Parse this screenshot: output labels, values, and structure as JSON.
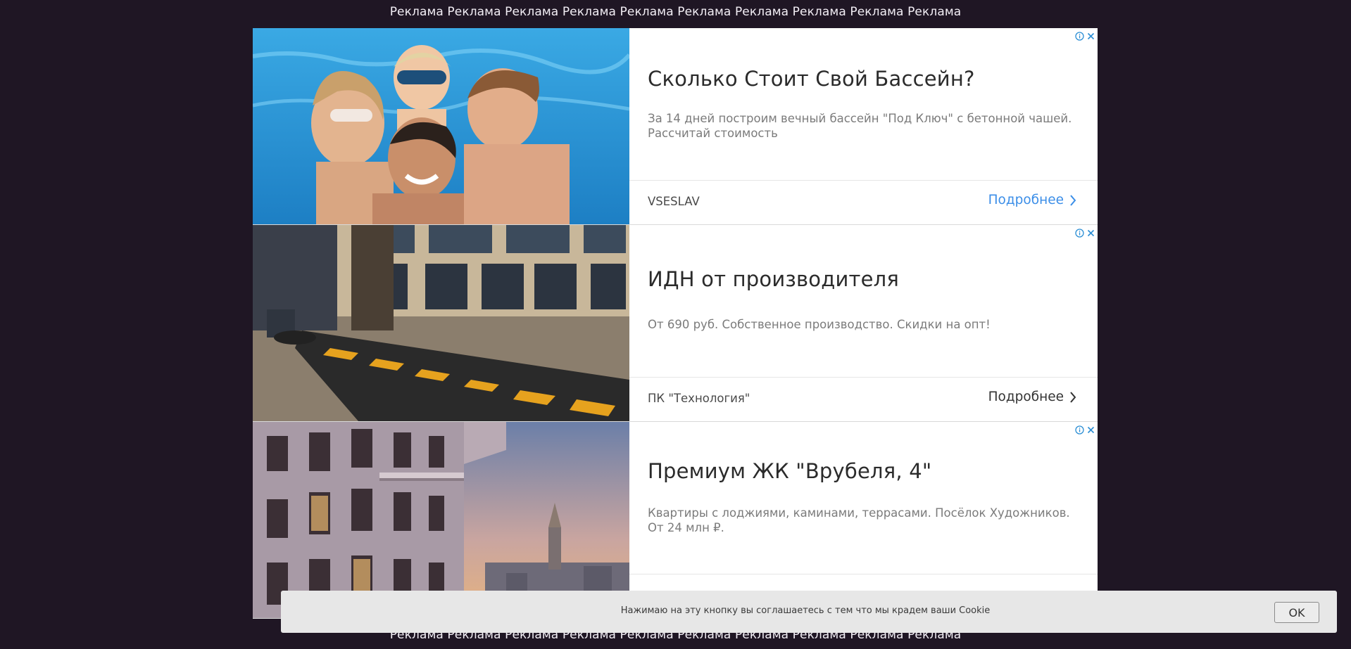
{
  "page": {
    "ad_strip_text": "Реклама Реклама Реклама Реклама Реклама Реклама Реклама Реклама Реклама Реклама"
  },
  "ads": [
    {
      "title": "Сколько Стоит Свой Бассейн?",
      "description": "За 14 дней построим вечный бассейн \"Под Ключ\" с бетонной чашей. Рассчитай стоимость",
      "advertiser": "VSESLAV",
      "cta_label": "Подробнее",
      "cta_color": "#3b8ee8",
      "image": "family-in-pool-photo"
    },
    {
      "title": "ИДН от производителя",
      "description": "От 690 руб. Собственное производство. Скидки на опт!",
      "advertiser": "ПК \"Технология\"",
      "cta_label": "Подробнее",
      "cta_color": "#333333",
      "image": "speed-bump-installation-photo"
    },
    {
      "title": "Премиум ЖК \"Врубеля, 4\"",
      "description": "Квартиры с лоджиями, каминами, террасами. Посёлок Художников. От 24 млн ₽.",
      "advertiser": "",
      "cta_label": "",
      "cta_color": "#3b8ee8",
      "image": "residential-building-moscow-photo"
    }
  ],
  "icons": {
    "info": "info-icon",
    "close": "close-icon",
    "chevron": "chevron-right-icon"
  },
  "cookie": {
    "message": "Нажимаю на эту кнопку вы соглашаетесь с тем что мы крадем ваши Cookie",
    "ok_label": "OK"
  },
  "colors": {
    "background": "#1f1624",
    "accent_blue": "#3b8ee8"
  }
}
